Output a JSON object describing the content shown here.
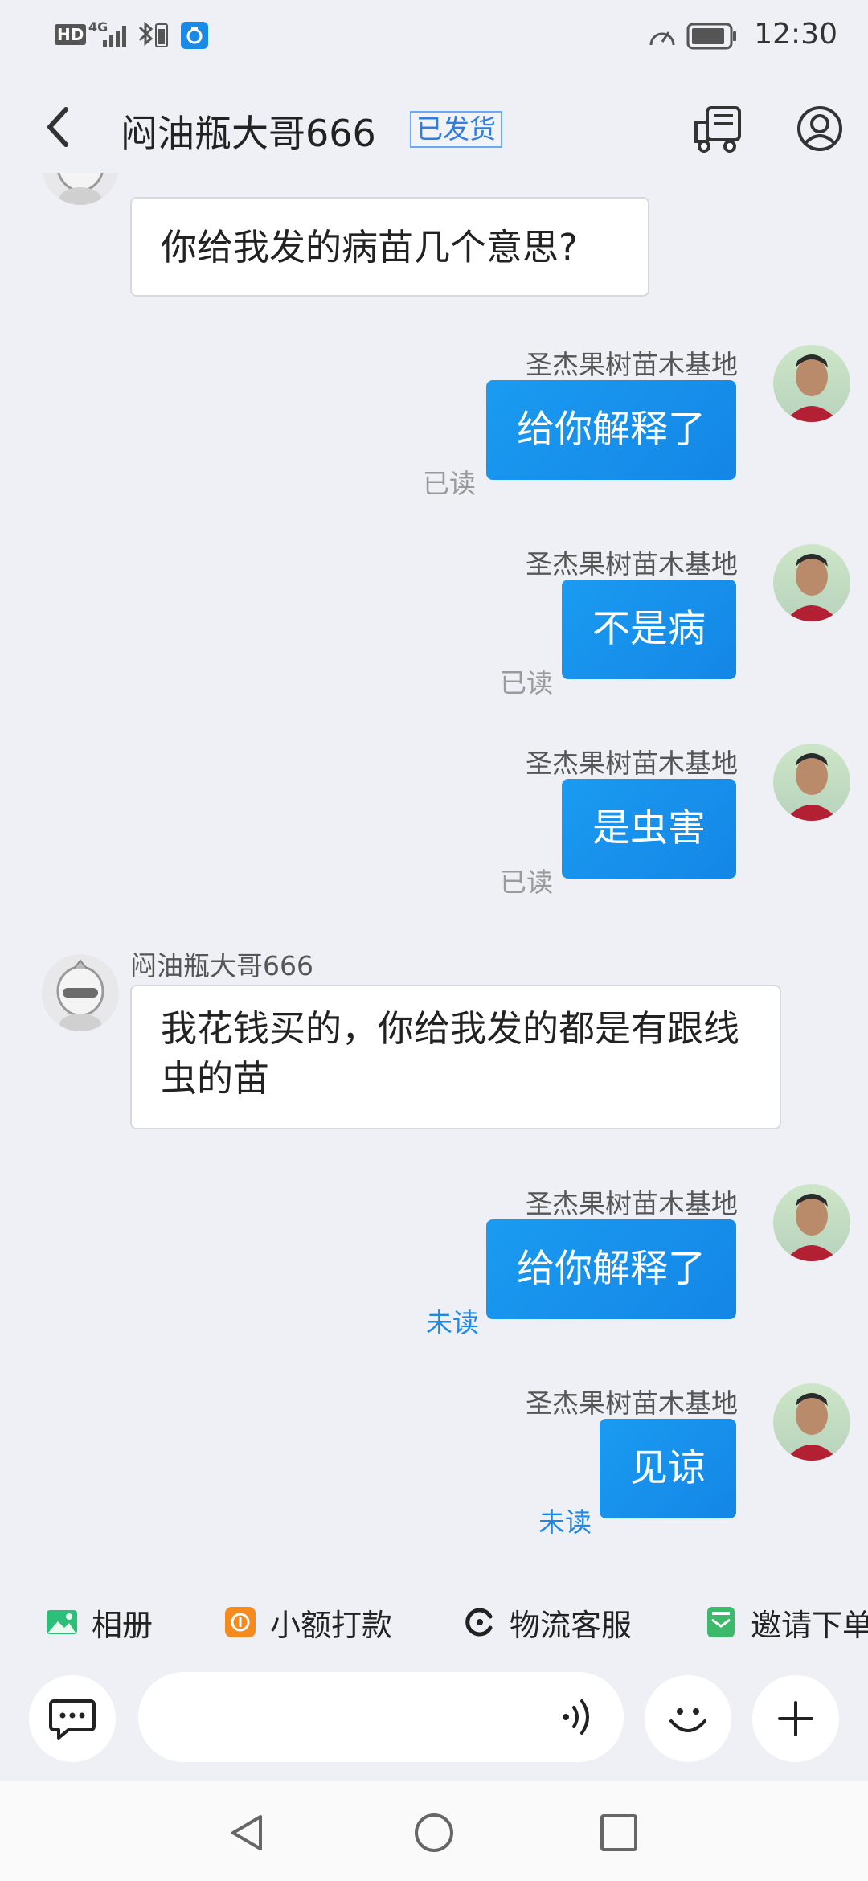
{
  "status_bar": {
    "network": "HD",
    "network_type": "4G",
    "time": "12:30"
  },
  "header": {
    "title": "闷油瓶大哥666",
    "badge": "已发货"
  },
  "messages": [
    {
      "direction": "in",
      "text": "你给我发的病苗几个意思?"
    },
    {
      "direction": "out",
      "sender": "圣杰果树苗木基地",
      "text": "给你解释了",
      "status": "已读"
    },
    {
      "direction": "out",
      "sender": "圣杰果树苗木基地",
      "text": "不是病",
      "status": "已读"
    },
    {
      "direction": "out",
      "sender": "圣杰果树苗木基地",
      "text": "是虫害",
      "status": "已读"
    },
    {
      "direction": "in",
      "sender": "闷油瓶大哥666",
      "text": "我花钱买的，你给我发的都是有跟线虫的苗"
    },
    {
      "direction": "out",
      "sender": "圣杰果树苗木基地",
      "text": "给你解释了",
      "status": "未读"
    },
    {
      "direction": "out",
      "sender": "圣杰果树苗木基地",
      "text": "见谅",
      "status": "未读"
    }
  ],
  "quick_actions": [
    {
      "label": "相册",
      "icon": "photo-album-icon"
    },
    {
      "label": "小额打款",
      "icon": "payment-icon"
    },
    {
      "label": "物流客服",
      "icon": "logistics-service-icon"
    },
    {
      "label": "邀请下单",
      "icon": "invite-order-icon"
    }
  ],
  "colors": {
    "accent": "#1a8ae6",
    "background": "#eff0f5",
    "outgoing_bubble": "#1a9bf1",
    "unread": "#1a8ae6",
    "read": "#9a9a9a"
  }
}
